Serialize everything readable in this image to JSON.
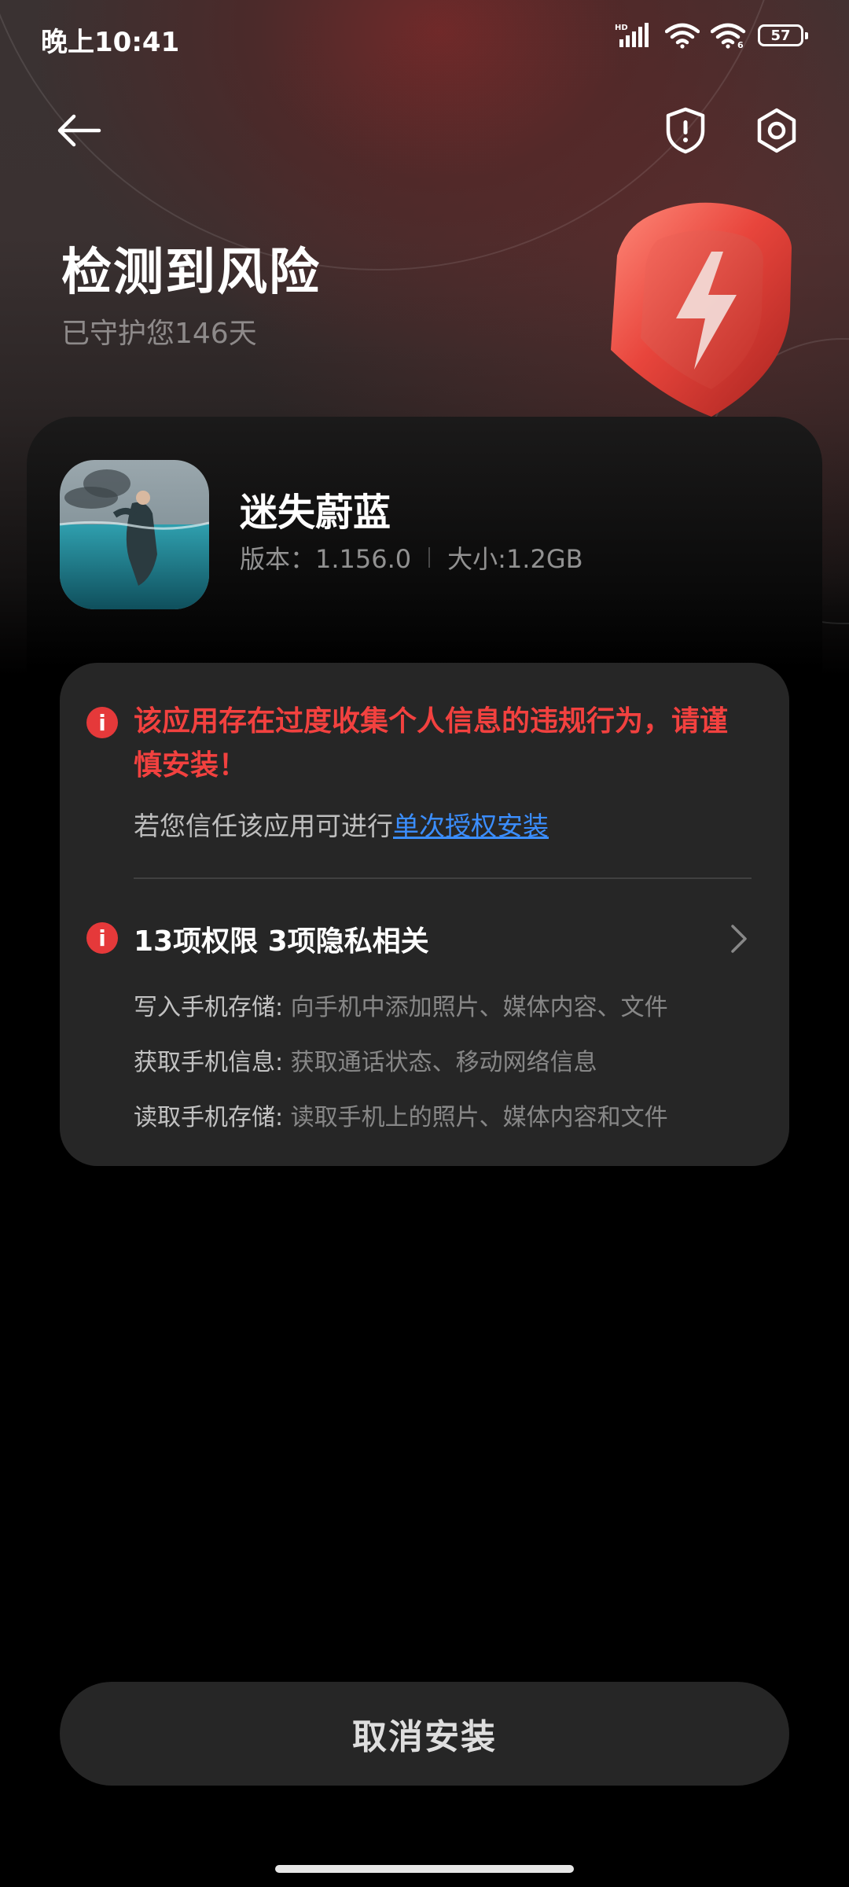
{
  "status_bar": {
    "time": "晚上10:41",
    "battery": "57",
    "hd_label": "HD"
  },
  "header": {
    "title": "检测到风险",
    "subtitle": "已守护您146天"
  },
  "app": {
    "name": "迷失蔚蓝",
    "version": "版本：1.156.0",
    "size": "大小:1.2GB"
  },
  "warning": {
    "title": "该应用存在过度收集个人信息的违规行为，请谨慎安装！",
    "trust_prefix": "若您信任该应用可进行",
    "trust_link": "单次授权安装"
  },
  "permissions": {
    "summary": "13项权限 3项隐私相关",
    "items": [
      {
        "label": "写入手机存储:",
        "desc": " 向手机中添加照片、媒体内容、文件"
      },
      {
        "label": "获取手机信息:",
        "desc": " 获取通话状态、移动网络信息"
      },
      {
        "label": "读取手机存储:",
        "desc": " 读取手机上的照片、媒体内容和文件"
      }
    ]
  },
  "actions": {
    "cancel_label": "取消安装"
  },
  "colors": {
    "warning_red": "#f2413f",
    "link_blue": "#3b8eff",
    "panel_bg": "#262626"
  },
  "icons": [
    "back-arrow-icon",
    "shield-alert-icon",
    "settings-icon",
    "info-icon",
    "chevron-right-icon",
    "lightning-shield-icon"
  ]
}
